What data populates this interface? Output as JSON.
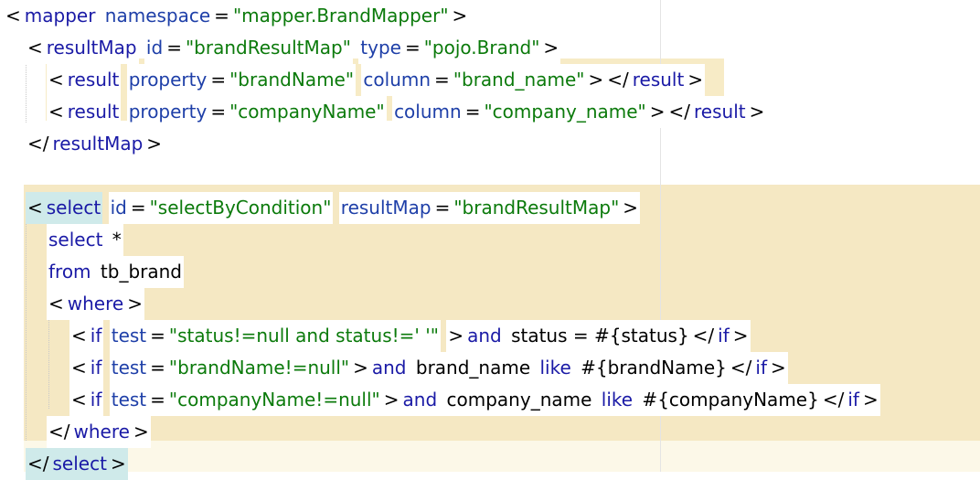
{
  "colors": {
    "result_highlight": "#f7ebc6",
    "select_highlight": "#f5e8c3",
    "select_tail": "#fcf8e8",
    "tag_match": "#cfeaea",
    "tag_color": "#1a1aa6",
    "attr_color": "#1e3fa8",
    "string_color": "#0b7a0b",
    "text_color": "#000000"
  },
  "lines": [
    {
      "indent": 0,
      "tokens": [
        {
          "c": "bracket",
          "t": "<"
        },
        {
          "c": "tag",
          "t": "mapper"
        },
        {
          "c": "text",
          "t": " "
        },
        {
          "c": "attr",
          "t": "namespace"
        },
        {
          "c": "bracket",
          "t": "="
        },
        {
          "c": "str",
          "t": "\"mapper.BrandMapper\""
        },
        {
          "c": "bracket",
          "t": ">"
        }
      ]
    },
    {
      "indent": 1,
      "tokens": [
        {
          "c": "bracket",
          "t": "<"
        },
        {
          "c": "tag",
          "t": "resultMap"
        },
        {
          "c": "text",
          "t": " "
        },
        {
          "c": "attr",
          "t": "id"
        },
        {
          "c": "bracket",
          "t": "="
        },
        {
          "c": "str",
          "t": "\"brandResultMap\""
        },
        {
          "c": "text",
          "t": " "
        },
        {
          "c": "attr",
          "t": "type"
        },
        {
          "c": "bracket",
          "t": "="
        },
        {
          "c": "str",
          "t": "\"pojo.Brand\""
        },
        {
          "c": "bracket",
          "t": ">"
        }
      ]
    },
    {
      "indent": 2,
      "tokens": [
        {
          "c": "bracket",
          "t": "<"
        },
        {
          "c": "tag",
          "t": "result"
        },
        {
          "c": "text",
          "t": " "
        },
        {
          "c": "attr",
          "t": "property"
        },
        {
          "c": "bracket",
          "t": "="
        },
        {
          "c": "str",
          "t": "\"brandName\""
        },
        {
          "c": "text",
          "t": " "
        },
        {
          "c": "attr",
          "t": "column"
        },
        {
          "c": "bracket",
          "t": "="
        },
        {
          "c": "str",
          "t": "\"brand_name\""
        },
        {
          "c": "bracket",
          "t": ">"
        },
        {
          "c": "bracket",
          "t": "</"
        },
        {
          "c": "tag",
          "t": "result"
        },
        {
          "c": "bracket",
          "t": ">"
        }
      ]
    },
    {
      "indent": 2,
      "tokens": [
        {
          "c": "bracket",
          "t": "<"
        },
        {
          "c": "tag",
          "t": "result"
        },
        {
          "c": "text",
          "t": " "
        },
        {
          "c": "attr",
          "t": "property"
        },
        {
          "c": "bracket",
          "t": "="
        },
        {
          "c": "str",
          "t": "\"companyName\""
        },
        {
          "c": "text",
          "t": " "
        },
        {
          "c": "attr",
          "t": "column"
        },
        {
          "c": "bracket",
          "t": "="
        },
        {
          "c": "str",
          "t": "\"company_name\""
        },
        {
          "c": "bracket",
          "t": ">"
        },
        {
          "c": "bracket",
          "t": "</"
        },
        {
          "c": "tag",
          "t": "result"
        },
        {
          "c": "bracket",
          "t": ">"
        }
      ]
    },
    {
      "indent": 1,
      "tokens": [
        {
          "c": "bracket",
          "t": "</"
        },
        {
          "c": "tag",
          "t": "resultMap"
        },
        {
          "c": "bracket",
          "t": ">"
        }
      ]
    },
    {
      "indent": 0,
      "tokens": []
    },
    {
      "indent": 1,
      "tokens": [
        {
          "c": "bracket",
          "t": "<",
          "m": true
        },
        {
          "c": "tag",
          "t": "select",
          "m": true
        },
        {
          "c": "text",
          "t": " "
        },
        {
          "c": "attr",
          "t": "id"
        },
        {
          "c": "bracket",
          "t": "="
        },
        {
          "c": "str",
          "t": "\"selectByCondition\""
        },
        {
          "c": "text",
          "t": " "
        },
        {
          "c": "attr",
          "t": "resultMap"
        },
        {
          "c": "bracket",
          "t": "="
        },
        {
          "c": "str",
          "t": "\"brandResultMap\""
        },
        {
          "c": "bracket",
          "t": ">"
        }
      ]
    },
    {
      "indent": 2,
      "tokens": [
        {
          "c": "kw",
          "t": "select"
        },
        {
          "c": "text",
          "t": " *"
        }
      ]
    },
    {
      "indent": 2,
      "tokens": [
        {
          "c": "kw",
          "t": "from"
        },
        {
          "c": "text",
          "t": " tb_brand"
        }
      ]
    },
    {
      "indent": 2,
      "tokens": [
        {
          "c": "bracket",
          "t": "<"
        },
        {
          "c": "tag",
          "t": "where"
        },
        {
          "c": "bracket",
          "t": ">"
        }
      ]
    },
    {
      "indent": 3,
      "tokens": [
        {
          "c": "bracket",
          "t": "<"
        },
        {
          "c": "tag",
          "t": "if"
        },
        {
          "c": "text",
          "t": " "
        },
        {
          "c": "attr",
          "t": "test"
        },
        {
          "c": "bracket",
          "t": "="
        },
        {
          "c": "str",
          "t": "\"status!=null and status!=' '\""
        },
        {
          "c": "text",
          "t": " "
        },
        {
          "c": "bracket",
          "t": ">"
        },
        {
          "c": "kw",
          "t": "and"
        },
        {
          "c": "text",
          "t": " status = #{status}"
        },
        {
          "c": "bracket",
          "t": "</"
        },
        {
          "c": "tag",
          "t": "if"
        },
        {
          "c": "bracket",
          "t": ">"
        }
      ]
    },
    {
      "indent": 3,
      "tokens": [
        {
          "c": "bracket",
          "t": "<"
        },
        {
          "c": "tag",
          "t": "if"
        },
        {
          "c": "text",
          "t": " "
        },
        {
          "c": "attr",
          "t": "test"
        },
        {
          "c": "bracket",
          "t": "="
        },
        {
          "c": "str",
          "t": "\"brandName!=null\""
        },
        {
          "c": "bracket",
          "t": ">"
        },
        {
          "c": "kw",
          "t": "and"
        },
        {
          "c": "text",
          "t": " brand_name "
        },
        {
          "c": "kw",
          "t": "like"
        },
        {
          "c": "text",
          "t": " #{brandName}"
        },
        {
          "c": "bracket",
          "t": "</"
        },
        {
          "c": "tag",
          "t": "if"
        },
        {
          "c": "bracket",
          "t": ">"
        }
      ]
    },
    {
      "indent": 3,
      "tokens": [
        {
          "c": "bracket",
          "t": "<"
        },
        {
          "c": "tag",
          "t": "if"
        },
        {
          "c": "text",
          "t": " "
        },
        {
          "c": "attr",
          "t": "test"
        },
        {
          "c": "bracket",
          "t": "="
        },
        {
          "c": "str",
          "t": "\"companyName!=null\""
        },
        {
          "c": "bracket",
          "t": ">"
        },
        {
          "c": "kw",
          "t": "and"
        },
        {
          "c": "text",
          "t": " company_name "
        },
        {
          "c": "kw",
          "t": "like"
        },
        {
          "c": "text",
          "t": " #{companyName}"
        },
        {
          "c": "bracket",
          "t": "</"
        },
        {
          "c": "tag",
          "t": "if"
        },
        {
          "c": "bracket",
          "t": ">"
        }
      ]
    },
    {
      "indent": 2,
      "tokens": [
        {
          "c": "bracket",
          "t": "</"
        },
        {
          "c": "tag",
          "t": "where"
        },
        {
          "c": "bracket",
          "t": ">"
        }
      ]
    },
    {
      "indent": 1,
      "tokens": [
        {
          "c": "bracket",
          "t": "</",
          "m": true
        },
        {
          "c": "tag",
          "t": "select",
          "m": true
        },
        {
          "c": "bracket",
          "t": ">",
          "m": true
        }
      ]
    }
  ]
}
